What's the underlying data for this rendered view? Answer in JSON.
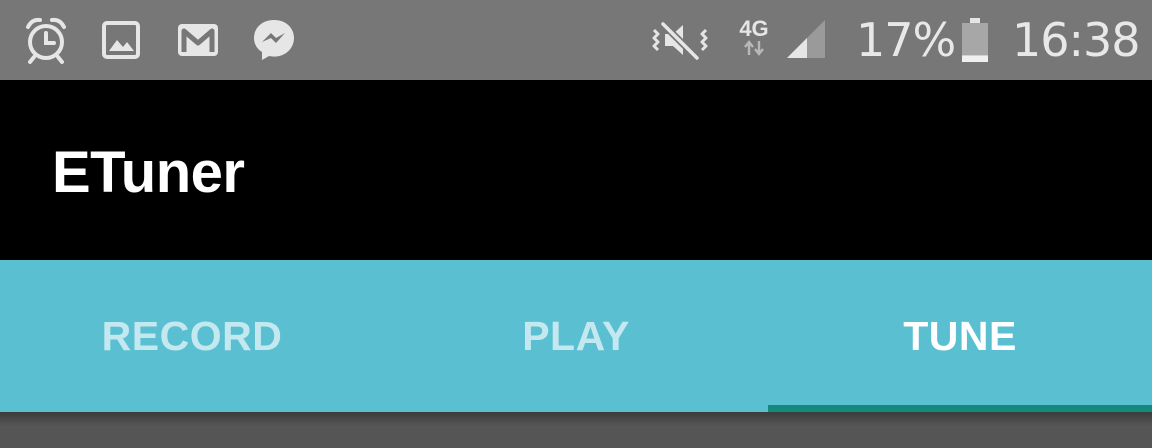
{
  "status_bar": {
    "left_icons": [
      "alarm-icon",
      "gallery-icon",
      "gmail-icon",
      "messenger-icon"
    ],
    "right_icons": [
      "mute-vibrate-icon",
      "signal-strength-icon",
      "battery-icon"
    ],
    "network_type": "4G",
    "battery_percent": "17%",
    "battery_level": 0.17,
    "time": "16:38",
    "background_color": "#777777"
  },
  "app_bar": {
    "title": "ETuner",
    "background_color": "#000000"
  },
  "tabs": {
    "items": [
      {
        "label": "RECORD",
        "selected": false
      },
      {
        "label": "PLAY",
        "selected": false
      },
      {
        "label": "TUNE",
        "selected": true
      }
    ],
    "background_color": "#5bbfd2",
    "indicator_color": "#15897c"
  }
}
